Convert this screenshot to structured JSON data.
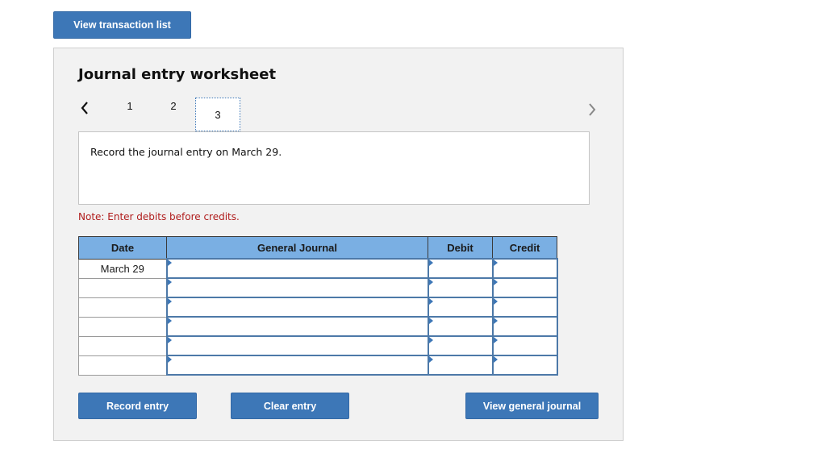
{
  "top_button": "View transaction list",
  "worksheet": {
    "title": "Journal entry worksheet",
    "tabs": [
      "1",
      "2",
      "3"
    ],
    "selected_tab": "3",
    "prev_icon": "chevron-left-icon",
    "next_icon": "chevron-right-icon",
    "question": "Record the journal entry on March 29.",
    "note": "Note: Enter debits before credits.",
    "note_color": "#b01c1c"
  },
  "table": {
    "headers": [
      "Date",
      "General Journal",
      "Debit",
      "Credit"
    ],
    "rows": [
      {
        "date": "March 29",
        "account": "",
        "debit": "",
        "credit": ""
      },
      {
        "date": "",
        "account": "",
        "debit": "",
        "credit": ""
      },
      {
        "date": "",
        "account": "",
        "debit": "",
        "credit": ""
      },
      {
        "date": "",
        "account": "",
        "debit": "",
        "credit": ""
      },
      {
        "date": "",
        "account": "",
        "debit": "",
        "credit": ""
      },
      {
        "date": "",
        "account": "",
        "debit": "",
        "credit": ""
      }
    ]
  },
  "buttons": {
    "record": "Record entry",
    "clear": "Clear entry",
    "view_journal": "View general journal"
  },
  "colors": {
    "button": "#3d77b7",
    "header": "#7aafe3"
  }
}
